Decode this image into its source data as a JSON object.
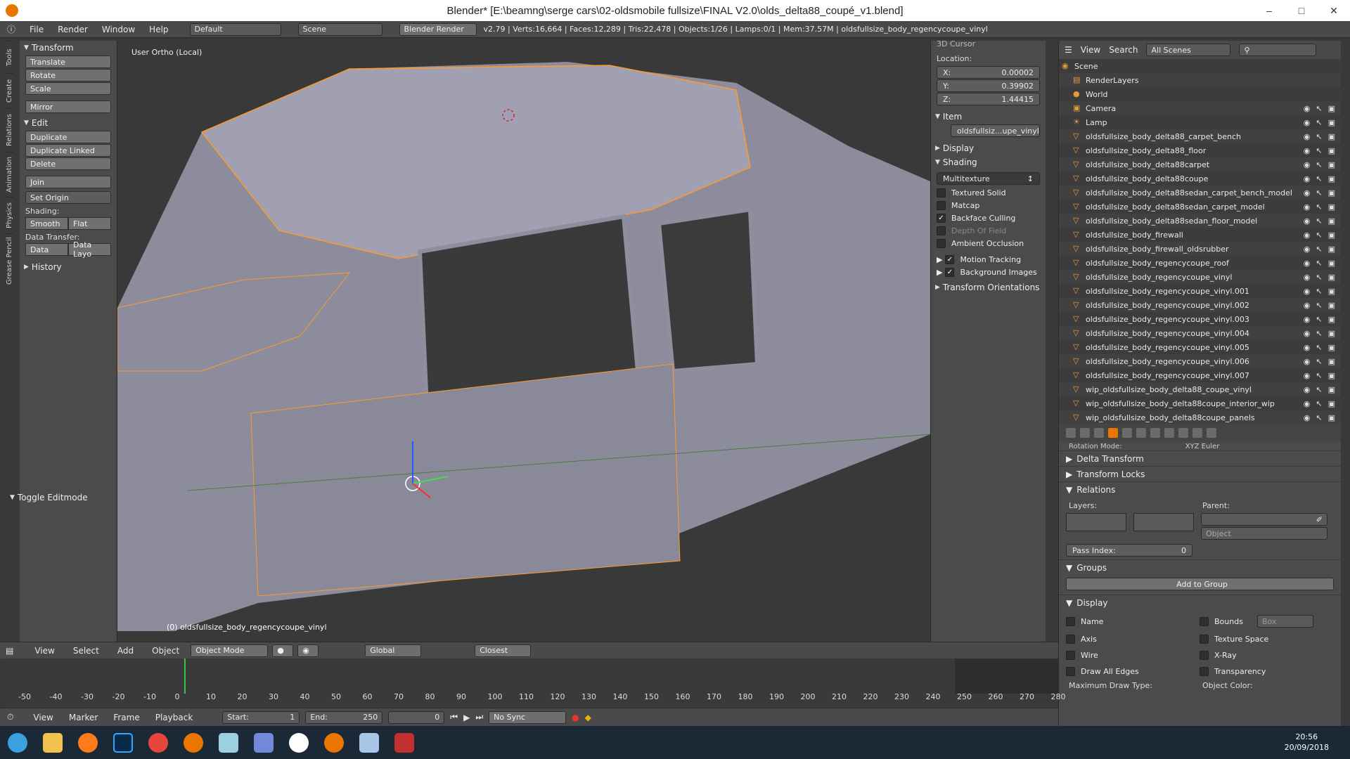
{
  "window": {
    "title": "Blender* [E:\\beamng\\serge cars\\02-oldsmobile fullsize\\FINAL V2.0\\olds_delta88_coupé_v1.blend]"
  },
  "menubar": {
    "file": "File",
    "render": "Render",
    "window": "Window",
    "help": "Help",
    "layout": "Default",
    "scene": "Scene",
    "engine": "Blender Render",
    "stats": "v2.79 | Verts:16,664 | Faces:12,289 | Tris:22,478 | Objects:1/26 | Lamps:0/1 | Mem:37.57M | oldsfullsize_body_regencycoupe_vinyl"
  },
  "left_tabs": [
    "Tools",
    "Create",
    "Relations",
    "Animation",
    "Physics",
    "Grease Pencil"
  ],
  "toolshelf": {
    "transform_title": "Transform",
    "translate": "Translate",
    "rotate": "Rotate",
    "scale": "Scale",
    "mirror": "Mirror",
    "edit_title": "Edit",
    "duplicate": "Duplicate",
    "duplicate_linked": "Duplicate Linked",
    "delete": "Delete",
    "join": "Join",
    "set_origin": "Set Origin",
    "shading_label": "Shading:",
    "smooth": "Smooth",
    "flat": "Flat",
    "data_transfer_label": "Data Transfer:",
    "data": "Data",
    "data_layo": "Data Layo",
    "history": "History",
    "toggle_editmode": "Toggle Editmode"
  },
  "viewport": {
    "label": "User Ortho (Local)",
    "object_label": "(0) oldsfullsize_body_regencycoupe_vinyl"
  },
  "npanel": {
    "cursor_title": "3D Cursor",
    "location_label": "Location:",
    "x": "X:",
    "x_val": "0.00002",
    "y": "Y:",
    "y_val": "0.39902",
    "z": "Z:",
    "z_val": "1.44415",
    "item_title": "Item",
    "item_name": "oldsfullsiz...upe_vinyl",
    "display_title": "Display",
    "shading_title": "Shading",
    "shading_mode": "Multitexture",
    "textured_solid": "Textured Solid",
    "matcap": "Matcap",
    "backface_culling": "Backface Culling",
    "depth_of_field": "Depth Of Field",
    "ambient_occlusion": "Ambient Occlusion",
    "motion_tracking": "Motion Tracking",
    "background_images": "Background Images",
    "transform_orientations": "Transform Orientations"
  },
  "outliner": {
    "view": "View",
    "search": "Search",
    "filter": "All Scenes",
    "rows": [
      {
        "name": "Scene",
        "icon": "scene"
      },
      {
        "name": "RenderLayers",
        "icon": "renderlayers"
      },
      {
        "name": "World",
        "icon": "world"
      },
      {
        "name": "Camera",
        "icon": "camera"
      },
      {
        "name": "Lamp",
        "icon": "lamp"
      },
      {
        "name": "oldsfullsize_body_delta88_carpet_bench",
        "icon": "mesh"
      },
      {
        "name": "oldsfullsize_body_delta88_floor",
        "icon": "mesh"
      },
      {
        "name": "oldsfullsize_body_delta88carpet",
        "icon": "mesh"
      },
      {
        "name": "oldsfullsize_body_delta88coupe",
        "icon": "mesh"
      },
      {
        "name": "oldsfullsize_body_delta88sedan_carpet_bench_model",
        "icon": "mesh"
      },
      {
        "name": "oldsfullsize_body_delta88sedan_carpet_model",
        "icon": "mesh"
      },
      {
        "name": "oldsfullsize_body_delta88sedan_floor_model",
        "icon": "mesh"
      },
      {
        "name": "oldsfullsize_body_firewall",
        "icon": "mesh"
      },
      {
        "name": "oldsfullsize_body_firewall_oldsrubber",
        "icon": "mesh"
      },
      {
        "name": "oldsfullsize_body_regencycoupe_roof",
        "icon": "mesh"
      },
      {
        "name": "oldsfullsize_body_regencycoupe_vinyl",
        "icon": "mesh"
      },
      {
        "name": "oldsfullsize_body_regencycoupe_vinyl.001",
        "icon": "mesh"
      },
      {
        "name": "oldsfullsize_body_regencycoupe_vinyl.002",
        "icon": "mesh"
      },
      {
        "name": "oldsfullsize_body_regencycoupe_vinyl.003",
        "icon": "mesh"
      },
      {
        "name": "oldsfullsize_body_regencycoupe_vinyl.004",
        "icon": "mesh"
      },
      {
        "name": "oldsfullsize_body_regencycoupe_vinyl.005",
        "icon": "mesh"
      },
      {
        "name": "oldsfullsize_body_regencycoupe_vinyl.006",
        "icon": "mesh"
      },
      {
        "name": "oldsfullsize_body_regencycoupe_vinyl.007",
        "icon": "mesh"
      },
      {
        "name": "wip_oldsfullsize_body_delta88_coupe_vinyl",
        "icon": "mesh"
      },
      {
        "name": "wip_oldsfullsize_body_delta88coupe_interior_wip",
        "icon": "mesh"
      },
      {
        "name": "wip_oldsfullsize_body_delta88coupe_panels",
        "icon": "mesh"
      }
    ]
  },
  "properties": {
    "rotation_mode": "Rotation Mode:",
    "rotation_value": "XYZ Euler",
    "delta_transform": "Delta Transform",
    "transform_locks": "Transform Locks",
    "relations": "Relations",
    "layers": "Layers:",
    "parent": "Parent:",
    "object": "Object",
    "pass_index": "Pass Index:",
    "pass_index_val": "0",
    "groups": "Groups",
    "add_to_group": "Add to Group",
    "display": "Display",
    "name": "Name",
    "bounds": "Bounds",
    "box": "Box",
    "axis": "Axis",
    "texture_space": "Texture Space",
    "wire": "Wire",
    "xray": "X-Ray",
    "draw_all_edges": "Draw All Edges",
    "transparency": "Transparency",
    "max_draw_type": "Maximum Draw Type:",
    "object_color": "Object Color:"
  },
  "viewport_header": {
    "view": "View",
    "select": "Select",
    "add": "Add",
    "object": "Object",
    "mode": "Object Mode",
    "orientation": "Global",
    "snap": "Closest"
  },
  "timeline": {
    "ticks": [
      "-50",
      "-40",
      "-30",
      "-20",
      "-10",
      "0",
      "10",
      "20",
      "30",
      "40",
      "50",
      "60",
      "70",
      "80",
      "90",
      "100",
      "110",
      "120",
      "130",
      "140",
      "150",
      "160",
      "170",
      "180",
      "190",
      "200",
      "210",
      "220",
      "230",
      "240",
      "250",
      "260",
      "270",
      "280"
    ]
  },
  "playbar": {
    "view": "View",
    "marker": "Marker",
    "frame": "Frame",
    "playback": "Playback",
    "start": "Start:",
    "start_val": "1",
    "end": "End:",
    "end_val": "250",
    "current": "0",
    "sync": "No Sync"
  },
  "taskbar": {
    "time": "20:56",
    "date": "20/09/2018"
  }
}
